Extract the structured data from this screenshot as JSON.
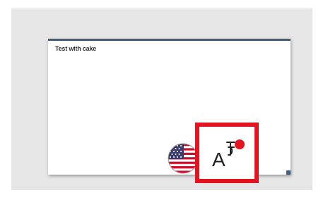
{
  "slide": {
    "title": "Test with cake"
  },
  "icons": {
    "flag": "us-flag-icon",
    "translate": "translate-icon",
    "notification_dot": "notification-dot-icon"
  },
  "translate_icon": {
    "letter": "A"
  },
  "colors": {
    "highlight": "#e3141f",
    "notification_dot": "#e3141f",
    "slide_accent": "#3f5e7e",
    "canvas_background": "#e6e6e6"
  }
}
